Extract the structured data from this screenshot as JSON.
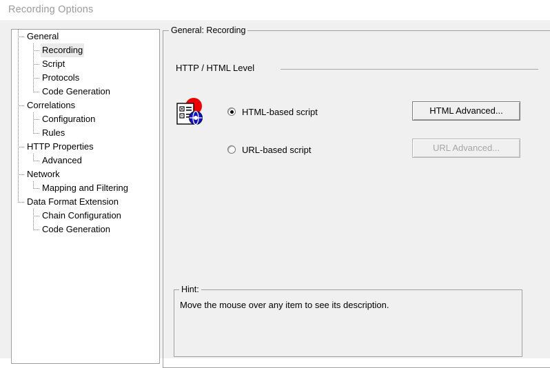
{
  "window": {
    "title": "Recording Options"
  },
  "tree": {
    "name": "options-tree",
    "items": [
      {
        "label": "General",
        "level": 1,
        "selected": false
      },
      {
        "label": "Recording",
        "level": 2,
        "selected": true
      },
      {
        "label": "Script",
        "level": 2,
        "selected": false
      },
      {
        "label": "Protocols",
        "level": 2,
        "selected": false
      },
      {
        "label": "Code Generation",
        "level": 2,
        "selected": false
      },
      {
        "label": "Correlations",
        "level": 1,
        "selected": false
      },
      {
        "label": "Configuration",
        "level": 2,
        "selected": false
      },
      {
        "label": "Rules",
        "level": 2,
        "selected": false
      },
      {
        "label": "HTTP Properties",
        "level": 1,
        "selected": false
      },
      {
        "label": "Advanced",
        "level": 2,
        "selected": false
      },
      {
        "label": "Network",
        "level": 1,
        "selected": false
      },
      {
        "label": "Mapping and Filtering",
        "level": 2,
        "selected": false
      },
      {
        "label": "Data Format Extension",
        "level": 1,
        "selected": false
      },
      {
        "label": "Chain Configuration",
        "level": 2,
        "selected": false
      },
      {
        "label": "Code Generation",
        "level": 2,
        "selected": false
      }
    ]
  },
  "main_group": {
    "caption": "General: Recording"
  },
  "section": {
    "title": "HTTP / HTML Level",
    "icon": "recording-options-icon"
  },
  "options": {
    "html_based": {
      "label": "HTML-based script",
      "checked": true
    },
    "url_based": {
      "label": "URL-based script",
      "checked": false
    }
  },
  "buttons": {
    "html_advanced": {
      "label": "HTML Advanced...",
      "enabled": true
    },
    "url_advanced": {
      "label": "URL Advanced...",
      "enabled": false
    }
  },
  "hint": {
    "caption": "Hint:",
    "text": "Move the mouse over any item to see its description."
  },
  "colors": {
    "dialog_background": "#f0f0f0",
    "panel_background": "#ffffff",
    "title_text": "#9b9b9b",
    "border": "#a0a0a0",
    "selection": "#ebebeb",
    "disabled_text": "#a6a6a6",
    "icon_red": "#ee0000",
    "icon_blue": "#1111cc"
  }
}
